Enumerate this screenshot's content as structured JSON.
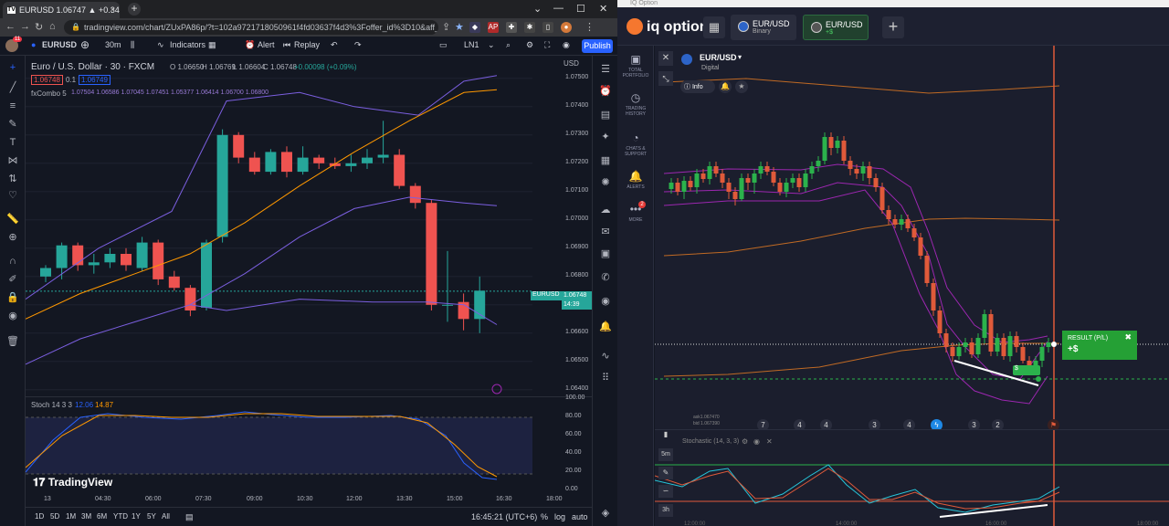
{
  "browser": {
    "tab_title": "EURUSD 1.06747 ▲ +0.34% LN1",
    "url": "tradingview.com/chart/ZUxPA86p/?t=102a9721718050961f4fd03637f4d3%3Foffer_id%3D10&aff_id=11468&...",
    "ext_badges": [
      "95",
      "AP"
    ]
  },
  "tv": {
    "symbol": "EURUSD",
    "interval": "30m",
    "indicators_label": "Indicators",
    "alert_label": "Alert",
    "replay_label": "Replay",
    "layout_label": "LN1",
    "publish_label": "Publish",
    "avatar_badge": "11",
    "instrument_title": "Euro / U.S. Dollar · 30 · FXCM",
    "ohlc": {
      "o": "O 1.06650",
      "h": "H 1.06769",
      "l": "L 1.06604",
      "c": "C 1.06748",
      "chg": "+0.00098 (+0.09%)"
    },
    "bid": "1.06748",
    "spread": "0.1",
    "ask": "1.06749",
    "fxcombo_label": "fxCombo 5",
    "fxcombo_values": "1.07504  1.06586  1.07045  1.07451  1.05377  1.06414  1.06700  1.06800",
    "currency": "USD",
    "price_ticks": [
      "1.07500",
      "1.07400",
      "1.07300",
      "1.07200",
      "1.07100",
      "1.07000",
      "1.06900",
      "1.06800",
      "1.06700",
      "1.06600",
      "1.06500",
      "1.06400"
    ],
    "price_badge": "EURUSD",
    "price_badge_value": "1.06748",
    "price_badge_time": "14:39",
    "stoch_label": "Stoch 14 3 3",
    "stoch_k": "12.06",
    "stoch_d": "14.87",
    "stoch_ticks": [
      "100.00",
      "80.00",
      "60.00",
      "40.00",
      "20.00",
      "0.00"
    ],
    "time_ticks": [
      "13",
      "04:30",
      "06:00",
      "07:30",
      "09:00",
      "10:30",
      "12:00",
      "13:30",
      "15:00",
      "16:30",
      "18:00"
    ],
    "watermark": "TradingView",
    "ranges": [
      "1D",
      "5D",
      "1M",
      "3M",
      "6M",
      "YTD",
      "1Y",
      "5Y",
      "All"
    ],
    "clock": "16:45:21 (UTC+6)",
    "pct_label": "%",
    "log_label": "log",
    "auto_label": "auto"
  },
  "iq": {
    "window_title": "IQ Option",
    "logo": "iq option",
    "tabs": [
      {
        "name": "EUR/USD",
        "sub": "Binary"
      },
      {
        "name": "EUR/USD",
        "sub": "+$"
      }
    ],
    "asset": "EUR/USD",
    "asset_type": "Digital",
    "info_label": "Info",
    "sidebar": [
      {
        "icon": "portfolio",
        "label": "TOTAL PORTFOLIO"
      },
      {
        "icon": "history",
        "label": "TRADING HISTORY"
      },
      {
        "icon": "chat",
        "label": "CHATS & SUPPORT"
      },
      {
        "icon": "bell",
        "label": "ALERTS"
      },
      {
        "icon": "more",
        "label": "MORE"
      }
    ],
    "more_badge": "2",
    "ask": "ask1.067470",
    "bid": "bid 1.067390",
    "markers": [
      "7",
      "4",
      "4",
      "3",
      "4",
      "3",
      "2"
    ],
    "result_title": "RESULT (P/L)",
    "result_value": "+$",
    "trade_label": "$",
    "stoch_label": "Stochastic (14, 3, 3)",
    "timeframes": [
      "5m",
      "3h"
    ],
    "time_ticks": [
      "12:00:00",
      "14:00:00",
      "16:00:00",
      "18:00:00"
    ]
  },
  "colors": {
    "tv_bg": "#131722",
    "up": "#26a69a",
    "down": "#ef5350",
    "accent": "#2962ff",
    "iq_up": "#2bb24c",
    "iq_down": "#e05a3a",
    "result_green": "#25a035"
  }
}
